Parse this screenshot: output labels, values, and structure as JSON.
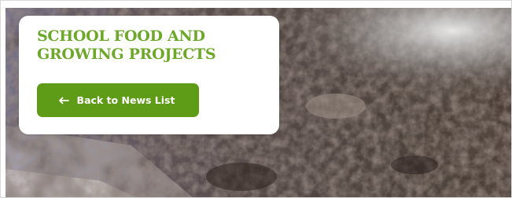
{
  "hero": {
    "image_subject": "soil-texture-photo"
  },
  "card": {
    "title": "SCHOOL FOOD AND GROWING PROJECTS",
    "back_button": {
      "label": "Back to News List",
      "icon": "arrow-left-icon"
    }
  },
  "colors": {
    "accent_green": "#6ea82b",
    "button_green": "#5e9b17",
    "card_background": "#ffffff"
  }
}
